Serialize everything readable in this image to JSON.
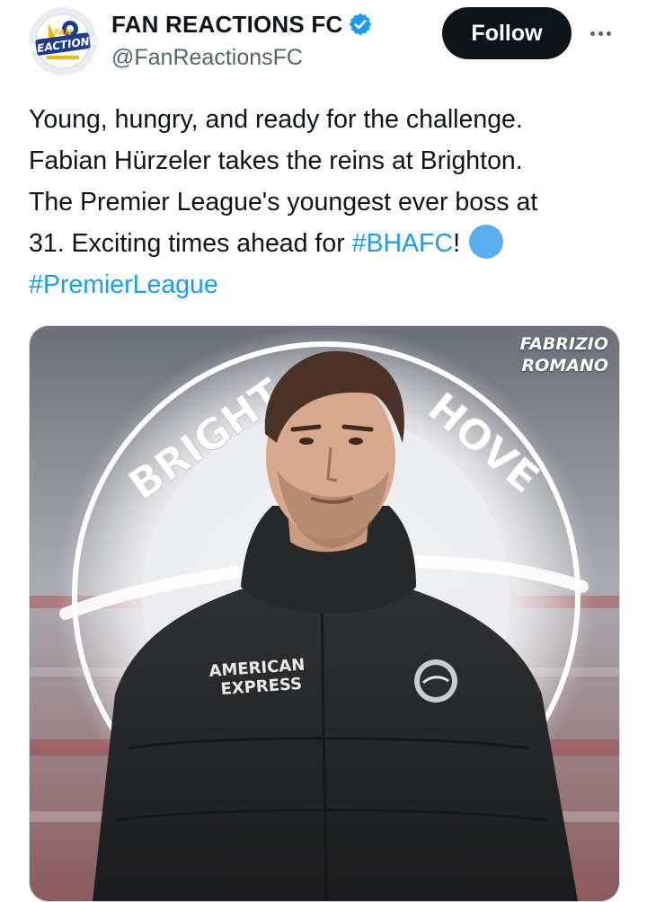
{
  "account": {
    "display_name": "FAN REACTIONS FC",
    "handle": "@FanReactionsFC",
    "avatar_text_top": "FAN",
    "avatar_text_main": "REACTIONS",
    "verified": true
  },
  "actions": {
    "follow_label": "Follow",
    "more_icon": "more-horizontal-icon"
  },
  "tweet": {
    "line1": "Young, hungry, and ready for the challenge.",
    "line2": "Fabian Hürzeler takes the reins at Brighton.",
    "line3": "The Premier League's youngest ever boss at",
    "line4_prefix": "31. Exciting times ahead for ",
    "hashtag1": "#BHAFC",
    "line4_suffix": "!",
    "hashtag2": "#PremierLeague"
  },
  "media": {
    "watermark_line1": "FABRIZIO",
    "watermark_line2": "ROMANO",
    "crest_text_left": "BRIGHT",
    "crest_text_right": "HOVE",
    "jacket_sponsor_line1": "AMERICAN",
    "jacket_sponsor_line2": "EXPRESS"
  },
  "colors": {
    "text": "#0f1419",
    "secondary": "#536471",
    "link": "#1d9bf0",
    "verified": "#1d9bf0",
    "follow_bg": "#0f1419"
  }
}
